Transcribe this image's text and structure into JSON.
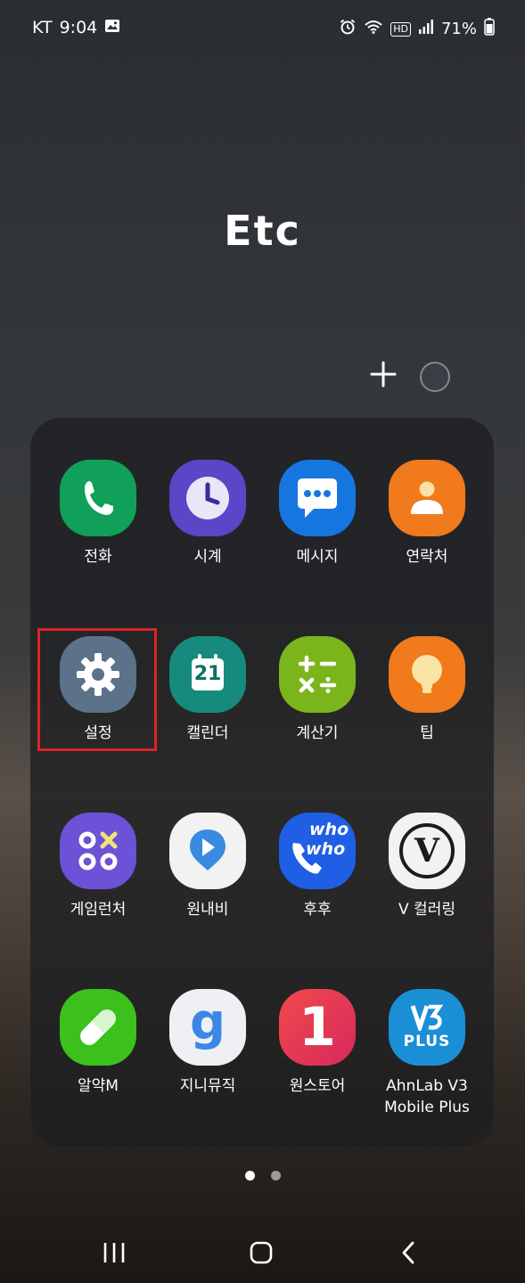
{
  "status_bar": {
    "carrier": "KT",
    "time": "9:04",
    "battery_percent": "71%",
    "network": "HD",
    "icons": [
      "image-icon",
      "alarm-icon",
      "wifi-icon",
      "signal-icon",
      "battery-icon"
    ]
  },
  "folder": {
    "title": "Etc",
    "apps": [
      {
        "label": "전화",
        "icon": "phone-icon",
        "color": "#11a05a"
      },
      {
        "label": "시계",
        "icon": "clock-icon",
        "color": "#5b46c7"
      },
      {
        "label": "메시지",
        "icon": "message-icon",
        "color": "#1676e0"
      },
      {
        "label": "연락처",
        "icon": "contacts-icon",
        "color": "#f07a1c"
      },
      {
        "label": "설정",
        "icon": "gear-icon",
        "color": "#5b7288"
      },
      {
        "label": "캘린더",
        "icon": "calendar-icon",
        "color": "#168a7c",
        "calendar_day": "21"
      },
      {
        "label": "계산기",
        "icon": "calculator-icon",
        "color": "#7bb51c"
      },
      {
        "label": "팁",
        "icon": "lightbulb-icon",
        "color": "#f07a1c"
      },
      {
        "label": "게임런처",
        "icon": "game-launcher-icon",
        "color": "#6b52d6"
      },
      {
        "label": "원내비",
        "icon": "navigation-icon",
        "color": "#f2f2f2"
      },
      {
        "label": "후후",
        "icon": "whowho-icon",
        "color": "#1f5fe6",
        "icon_text": [
          "who",
          "who"
        ]
      },
      {
        "label": "V 컬러링",
        "icon": "v-coloring-icon",
        "color": "#f2f2f2",
        "icon_text": [
          "V"
        ]
      },
      {
        "label": "알약M",
        "icon": "pill-icon",
        "color": "#3cc11c"
      },
      {
        "label": "지니뮤직",
        "icon": "genie-music-icon",
        "color": "#eef0f3",
        "icon_text": [
          "g"
        ]
      },
      {
        "label": "원스토어",
        "icon": "onestore-icon",
        "color": "#e8384c",
        "icon_text": [
          "1"
        ]
      },
      {
        "label": "AhnLab V3 Mobile Plus",
        "icon": "ahnlab-v3-icon",
        "color": "#1a8fd6",
        "icon_text": [
          "PLUS"
        ]
      }
    ]
  },
  "colors": {
    "highlight": "#d9252a",
    "page_dot_active": "#ffffff",
    "page_dot_inactive": "#9a9a9a"
  },
  "pages": {
    "count": 2,
    "active": 1
  }
}
